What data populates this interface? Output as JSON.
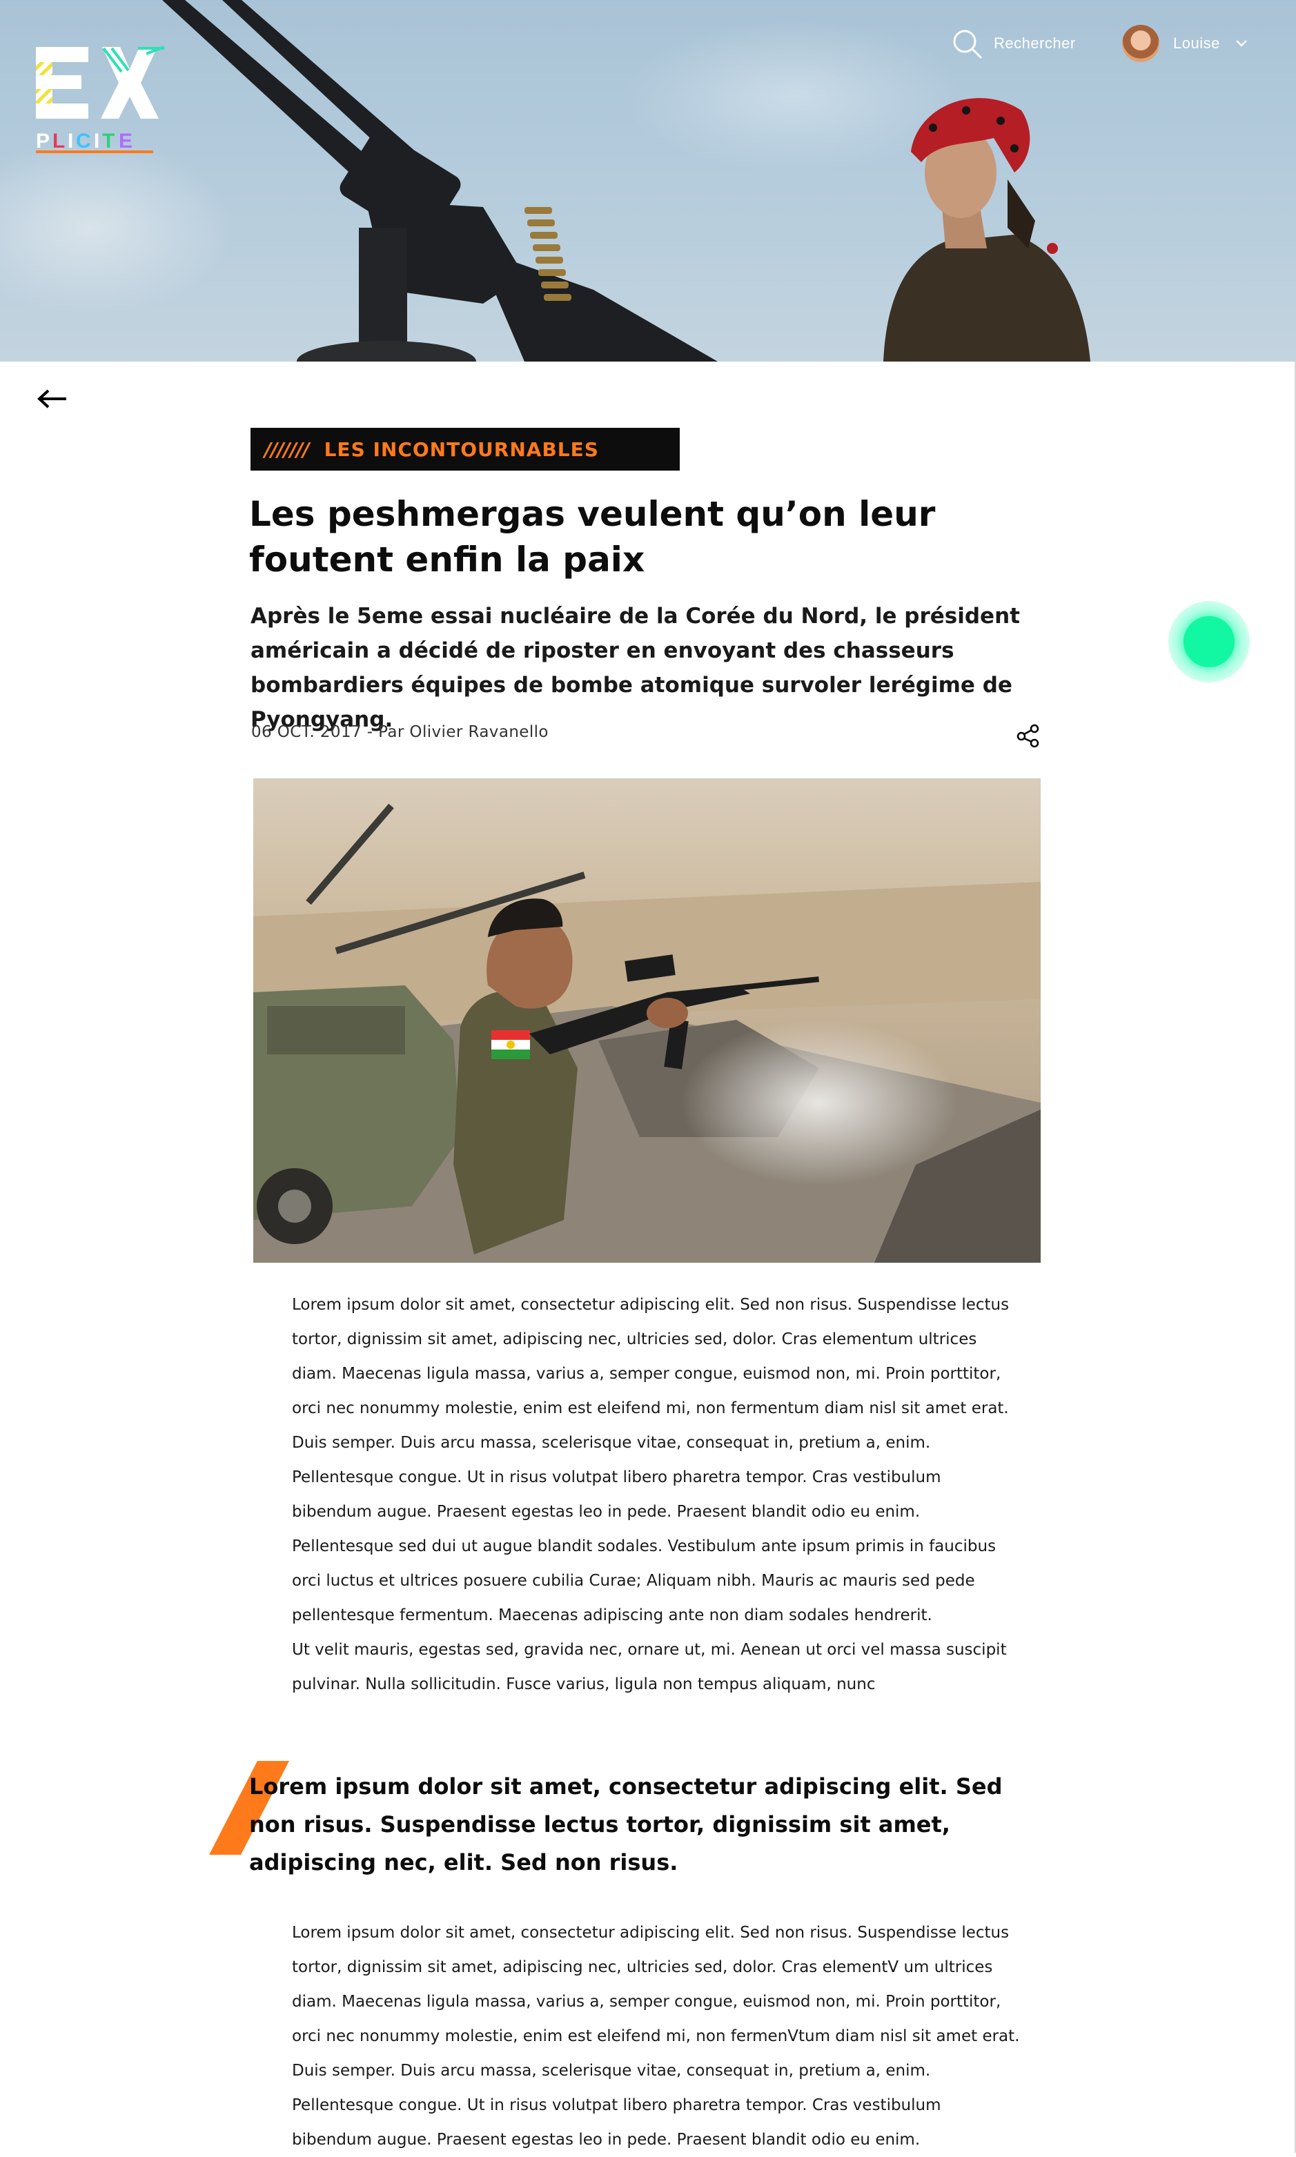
{
  "header": {
    "logo_text_top": "EX",
    "logo_text_bottom": "PLICITE",
    "search_label": "Rechercher",
    "user_name": "Louise",
    "icons": {
      "search": "search-icon",
      "chevron": "chevron-down-icon",
      "avatar": "user-avatar"
    }
  },
  "navigation": {
    "back_icon": "arrow-left-icon"
  },
  "article": {
    "category_stripes": "///////",
    "category": "LES INCONTOURNABLES",
    "title": "Les peshmergas veulent qu’on leur foutent enfin la paix",
    "subtitle": "Après le 5eme essai nucléaire de la Corée du Nord, le président américain a décidé de riposter en envoyant des chasseurs bombardiers équipes de bombe atomique survoler lerégime de Pyongyang.",
    "meta": "06 OCT. 2017 - Par Olivier Ravanello",
    "share_icon": "share-icon",
    "paragraph_1a": "Lorem ipsum dolor sit amet, consectetur adipiscing elit. Sed non risus. Suspendisse lectus tortor, dignissim sit amet, adipiscing nec, ultricies sed, dolor. Cras elementum ultrices diam. Maecenas ligula massa, varius a, semper congue, euismod non, mi. Proin porttitor, orci nec nonummy molestie, enim est eleifend mi, non fermentum diam nisl sit amet erat. Duis semper. Duis arcu massa, scelerisque vitae, consequat in, pretium a, enim. Pellentesque congue. Ut in risus volutpat libero pharetra tempor. Cras vestibulum bibendum augue. Praesent egestas leo in pede. Praesent blandit odio eu enim. Pellentesque sed dui ut augue blandit sodales. Vestibulum ante ipsum primis in faucibus orci luctus et ultrices posuere cubilia Curae; Aliquam nibh. Mauris ac mauris sed pede pellentesque fermentum. Maecenas adipiscing ante non diam sodales hendrerit.",
    "paragraph_1b": "Ut velit mauris, egestas sed, gravida nec, ornare ut, mi. Aenean ut orci vel massa suscipit pulvinar. Nulla sollicitudin. Fusce varius, ligula non tempus aliquam, nunc",
    "quote": "Lorem ipsum dolor sit amet, consectetur adipiscing elit. Sed non risus. Suspendisse lectus tortor, dignissim sit amet, adipiscing nec, elit. Sed non risus.",
    "paragraph_2": "Lorem ipsum dolor sit amet, consectetur adipiscing elit. Sed non risus. Suspendisse lectus tortor, dignissim sit amet, adipiscing nec, ultricies sed, dolor. Cras elementV um ultrices diam. Maecenas ligula massa, varius a, semper congue, euismod non, mi. Proin porttitor, orci nec nonummy molestie, enim est eleifend mi, non fermenVtum diam nisl sit amet erat. Duis semper. Duis arcu massa, scelerisque vitae, consequat in, pretium a, enim. Pellentesque congue. Ut in risus volutpat libero pharetra tempor. Cras vestibulum bibendum augue. Praesent egestas leo in pede. Praesent blandit odio eu enim."
  },
  "colors": {
    "accent_orange": "#ff7a1a",
    "tag_background": "#0d0d0d",
    "fab_green": "#12f7a1",
    "logo_yellow": "#f0e23a",
    "logo_teal": "#2fe0b5"
  }
}
